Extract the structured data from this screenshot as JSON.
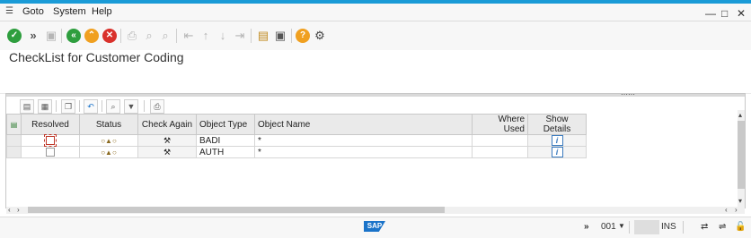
{
  "menubar": {
    "items": [
      {
        "label": "Goto"
      },
      {
        "label": "System"
      },
      {
        "label": "Help"
      }
    ]
  },
  "window_controls": {
    "minimize": "—",
    "maximize": "□",
    "close": "✕"
  },
  "toolbar": {
    "icons": [
      "enter-icon",
      "next-icon",
      "save-icon",
      "back-icon",
      "exit-icon",
      "cancel-icon",
      "print-icon",
      "find-icon",
      "find-next-icon",
      "first-page-icon",
      "previous-page-icon",
      "next-page-icon",
      "last-page-icon",
      "create-session-icon",
      "shortcut-icon",
      "help-icon",
      "customize-layout-icon"
    ]
  },
  "page": {
    "title": "CheckList for Customer Coding"
  },
  "alv_toolbar": {
    "icons": [
      "details-icon",
      "select-all-icon",
      "copy-icon",
      "undo-icon",
      "find-icon",
      "filter-icon",
      "print-icon"
    ]
  },
  "grid": {
    "columns": [
      {
        "label": "Resolved"
      },
      {
        "label": "Status"
      },
      {
        "label": "Check Again"
      },
      {
        "label": "Object Type"
      },
      {
        "label": "Object Name"
      },
      {
        "label": "Where Used"
      },
      {
        "label": "Show Details"
      }
    ],
    "rows": [
      {
        "resolved": false,
        "status": "○▲○",
        "object_type": "BADI",
        "object_name": "*",
        "where_used": ""
      },
      {
        "resolved": false,
        "status": "○▲○",
        "object_type": "AUTH",
        "object_name": "*",
        "where_used": ""
      }
    ]
  },
  "statusbar": {
    "logo": "SAP",
    "client": "001",
    "mode": "INS"
  },
  "colors": {
    "accent": "#1a9bd7",
    "enter_green": "#2e9e3e",
    "exit_orange": "#f0a020",
    "cancel_red": "#d9312b",
    "help_orange": "#f0a020"
  }
}
